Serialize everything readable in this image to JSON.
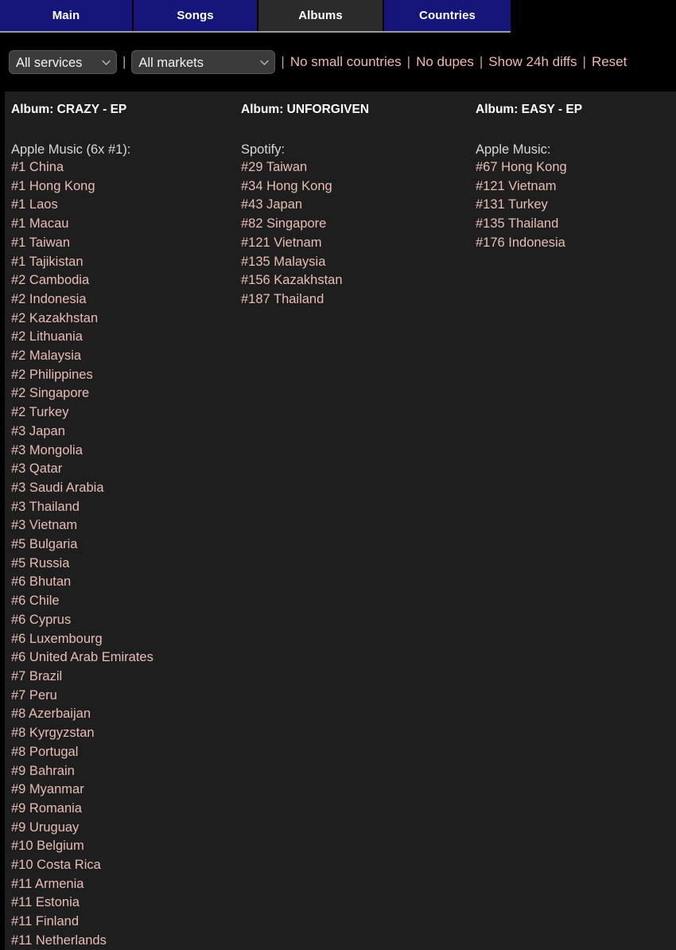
{
  "tabs": [
    {
      "label": "Main",
      "active": false
    },
    {
      "label": "Songs",
      "active": false
    },
    {
      "label": "Albums",
      "active": true
    },
    {
      "label": "Countries",
      "active": false
    }
  ],
  "filters": {
    "service_select": {
      "value": "All services",
      "options": [
        "All services"
      ]
    },
    "market_select": {
      "value": "All markets",
      "options": [
        "All markets"
      ]
    },
    "separator": "|",
    "links": [
      "No small countries",
      "No dupes",
      "Show 24h diffs",
      "Reset"
    ]
  },
  "colors": {
    "page_background": "#000000",
    "panel_background": "#1e1e1e",
    "tab_inactive": "#16167a",
    "tab_active": "#2b2b2b",
    "tab_text": "#ffffff",
    "link_pink": "#edb8b2",
    "entry_pink": "#e8bcb5",
    "service_gray": "#d8d8d8",
    "title_white": "#ffffff"
  },
  "columns": [
    {
      "album_title": "Album: CRAZY - EP",
      "service": "Apple Music (6x #1):",
      "entries": [
        "#1 China",
        "#1 Hong Kong",
        "#1 Laos",
        "#1 Macau",
        "#1 Taiwan",
        "#1 Tajikistan",
        "#2 Cambodia",
        "#2 Indonesia",
        "#2 Kazakhstan",
        "#2 Lithuania",
        "#2 Malaysia",
        "#2 Philippines",
        "#2 Singapore",
        "#2 Turkey",
        "#3 Japan",
        "#3 Mongolia",
        "#3 Qatar",
        "#3 Saudi Arabia",
        "#3 Thailand",
        "#3 Vietnam",
        "#5 Bulgaria",
        "#5 Russia",
        "#6 Bhutan",
        "#6 Chile",
        "#6 Cyprus",
        "#6 Luxembourg",
        "#6 United Arab Emirates",
        "#7 Brazil",
        "#7 Peru",
        "#8 Azerbaijan",
        "#8 Kyrgyzstan",
        "#8 Portugal",
        "#9 Bahrain",
        "#9 Myanmar",
        "#9 Romania",
        "#9 Uruguay",
        "#10 Belgium",
        "#10 Costa Rica",
        "#11 Armenia",
        "#11 Estonia",
        "#11 Finland",
        "#11 Netherlands"
      ]
    },
    {
      "album_title": "Album: UNFORGIVEN",
      "service": "Spotify:",
      "entries": [
        "#29 Taiwan",
        "#34 Hong Kong",
        "#43 Japan",
        "#82 Singapore",
        "#121 Vietnam",
        "#135 Malaysia",
        "#156 Kazakhstan",
        "#187 Thailand"
      ]
    },
    {
      "album_title": "Album: EASY - EP",
      "service": "Apple Music:",
      "entries": [
        "#67 Hong Kong",
        "#121 Vietnam",
        "#131 Turkey",
        "#135 Thailand",
        "#176 Indonesia"
      ]
    }
  ]
}
